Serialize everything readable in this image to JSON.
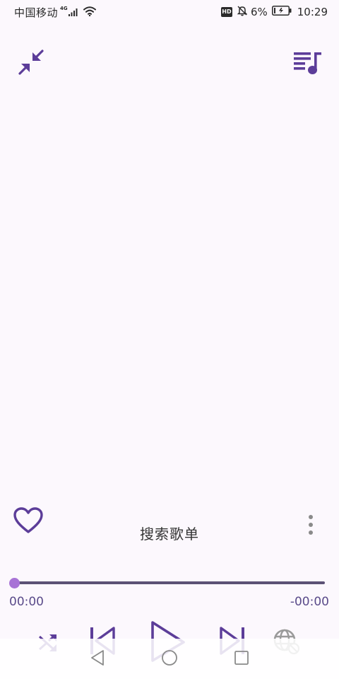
{
  "status_bar": {
    "carrier": "中国移动",
    "network_type": "4G",
    "hd_badge": "HD",
    "battery_percent": "6%",
    "time": "10:29"
  },
  "header": {
    "collapse_icon": "collapse-arrows-icon",
    "queue_icon": "playlist-music-icon"
  },
  "song": {
    "title": "搜索歌单",
    "favorite_icon": "heart-outline-icon",
    "more_icon": "more-vertical-icon"
  },
  "progress": {
    "elapsed": "00:00",
    "remaining": "-00:00",
    "fraction": 0
  },
  "controls": {
    "shuffle_icon": "shuffle-icon",
    "prev_icon": "skip-previous-icon",
    "play_icon": "play-icon",
    "next_icon": "skip-next-icon",
    "remote_icon": "web-off-icon"
  },
  "nav_bar": {
    "back_icon": "back-triangle-icon",
    "home_icon": "home-circle-icon",
    "recents_icon": "recents-square-icon"
  },
  "colors": {
    "accent": "#5c3d99",
    "progress_thumb": "#a873d6",
    "time_text": "#5a4b8a",
    "background": "#fcf8fd"
  }
}
